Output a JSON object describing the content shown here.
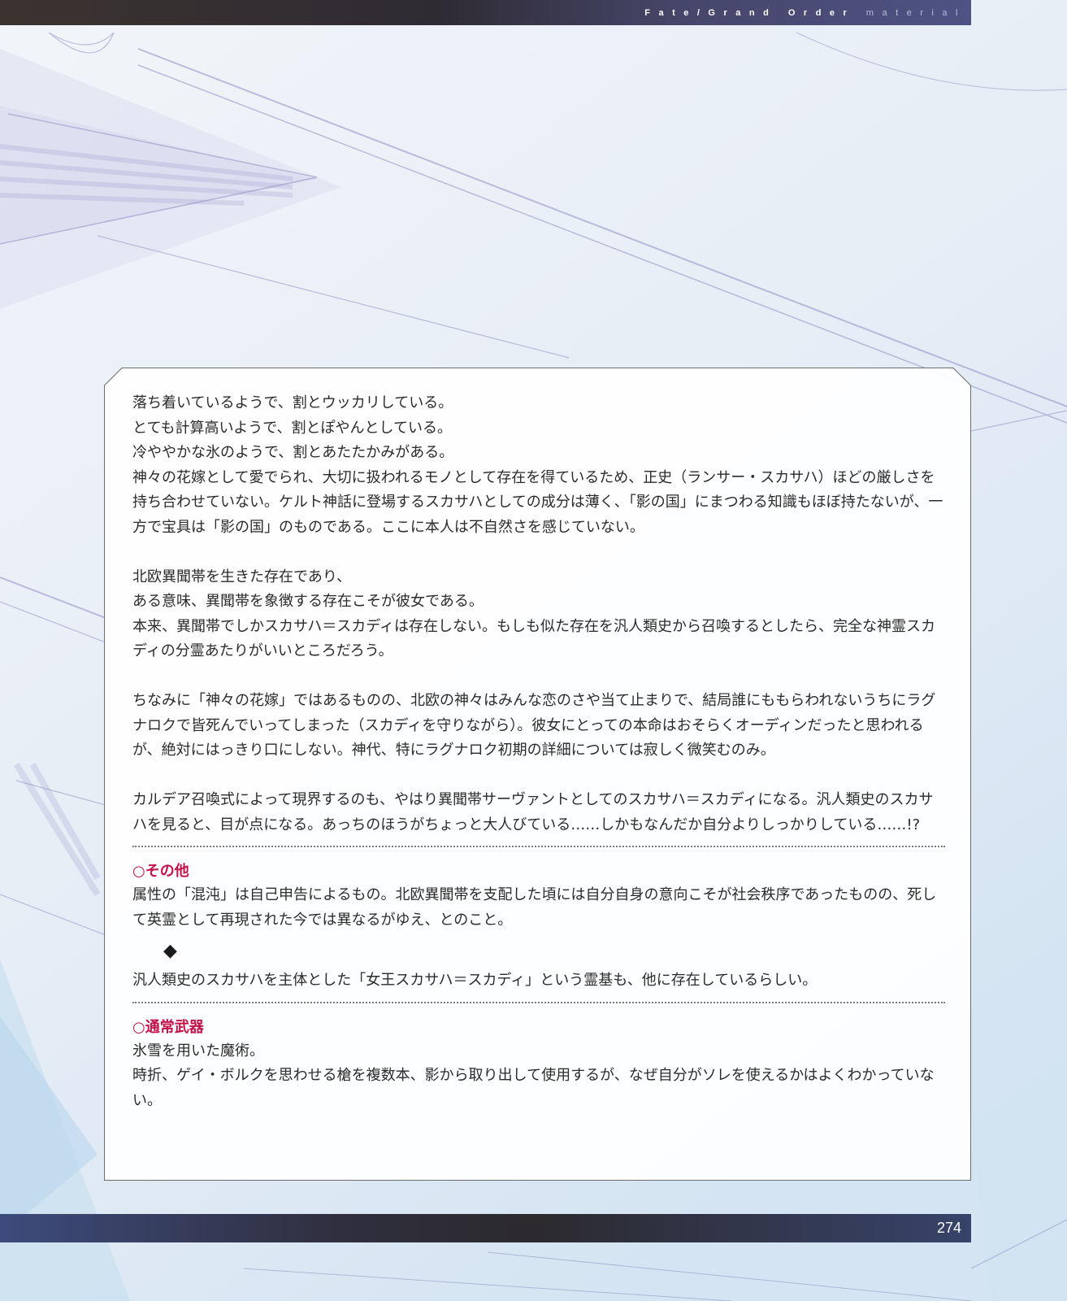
{
  "header": {
    "title_bold": "Fate/Grand Order",
    "title_light": "material"
  },
  "body": {
    "paragraphs_1": [
      "落ち着いているようで、割とウッカリしている。",
      "とても計算高いようで、割とぽやんとしている。",
      "冷ややかな氷のようで、割とあたたかみがある。",
      "神々の花嫁として愛でられ、大切に扱われるモノとして存在を得ているため、正史（ランサー・スカサハ）ほどの厳しさを持ち合わせていない。ケルト神話に登場するスカサハとしての成分は薄く、「影の国」にまつわる知識もほぼ持たないが、一方で宝具は「影の国」のものである。ここに本人は不自然さを感じていない。"
    ],
    "paragraphs_2": [
      "北欧異聞帯を生きた存在であり、",
      "ある意味、異聞帯を象徴する存在こそが彼女である。",
      "本来、異聞帯でしかスカサハ＝スカディは存在しない。もしも似た存在を汎人類史から召喚するとしたら、完全な神霊スカディの分霊あたりがいいところだろう。"
    ],
    "paragraph_3": "ちなみに「神々の花嫁」ではあるものの、北欧の神々はみんな恋のさや当て止まりで、結局誰にももらわれないうちにラグナロクで皆死んでいってしまった（スカディを守りながら）。彼女にとっての本命はおそらくオーディンだったと思われるが、絶対にはっきり口にしない。神代、特にラグナロク初期の詳細については寂しく微笑むのみ。",
    "paragraph_4": "カルデア召喚式によって現界するのも、やはり異聞帯サーヴァントとしてのスカサハ＝スカディになる。汎人類史のスカサハを見ると、目が点になる。あっちのほうがちょっと大人びている……しかもなんだか自分よりしっかりしている……!?"
  },
  "section_other": {
    "heading": "○その他",
    "text": "属性の「混沌」は自己申告によるもの。北欧異聞帯を支配した頃には自分自身の意向こそが社会秩序であったものの、死して英霊として再現された今では異なるがゆえ、とのこと。",
    "diamond": "◆",
    "note": "汎人類史のスカサハを主体とした「女王スカサハ＝スカディ」という霊基も、他に存在しているらしい。"
  },
  "section_weapon": {
    "heading": "○通常武器",
    "lines": [
      "氷雪を用いた魔術。",
      "時折、ゲイ・ボルクを思わせる槍を複数本、影から取り出して使用するが、なぜ自分がソレを使えるかはよくわかっていない。"
    ]
  },
  "footer": {
    "page_number": "274"
  },
  "colors": {
    "accent": "#c2134a",
    "text": "#2b2b2b",
    "bar_dark": "#2f2b33",
    "bar_blue": "#4e5384"
  }
}
